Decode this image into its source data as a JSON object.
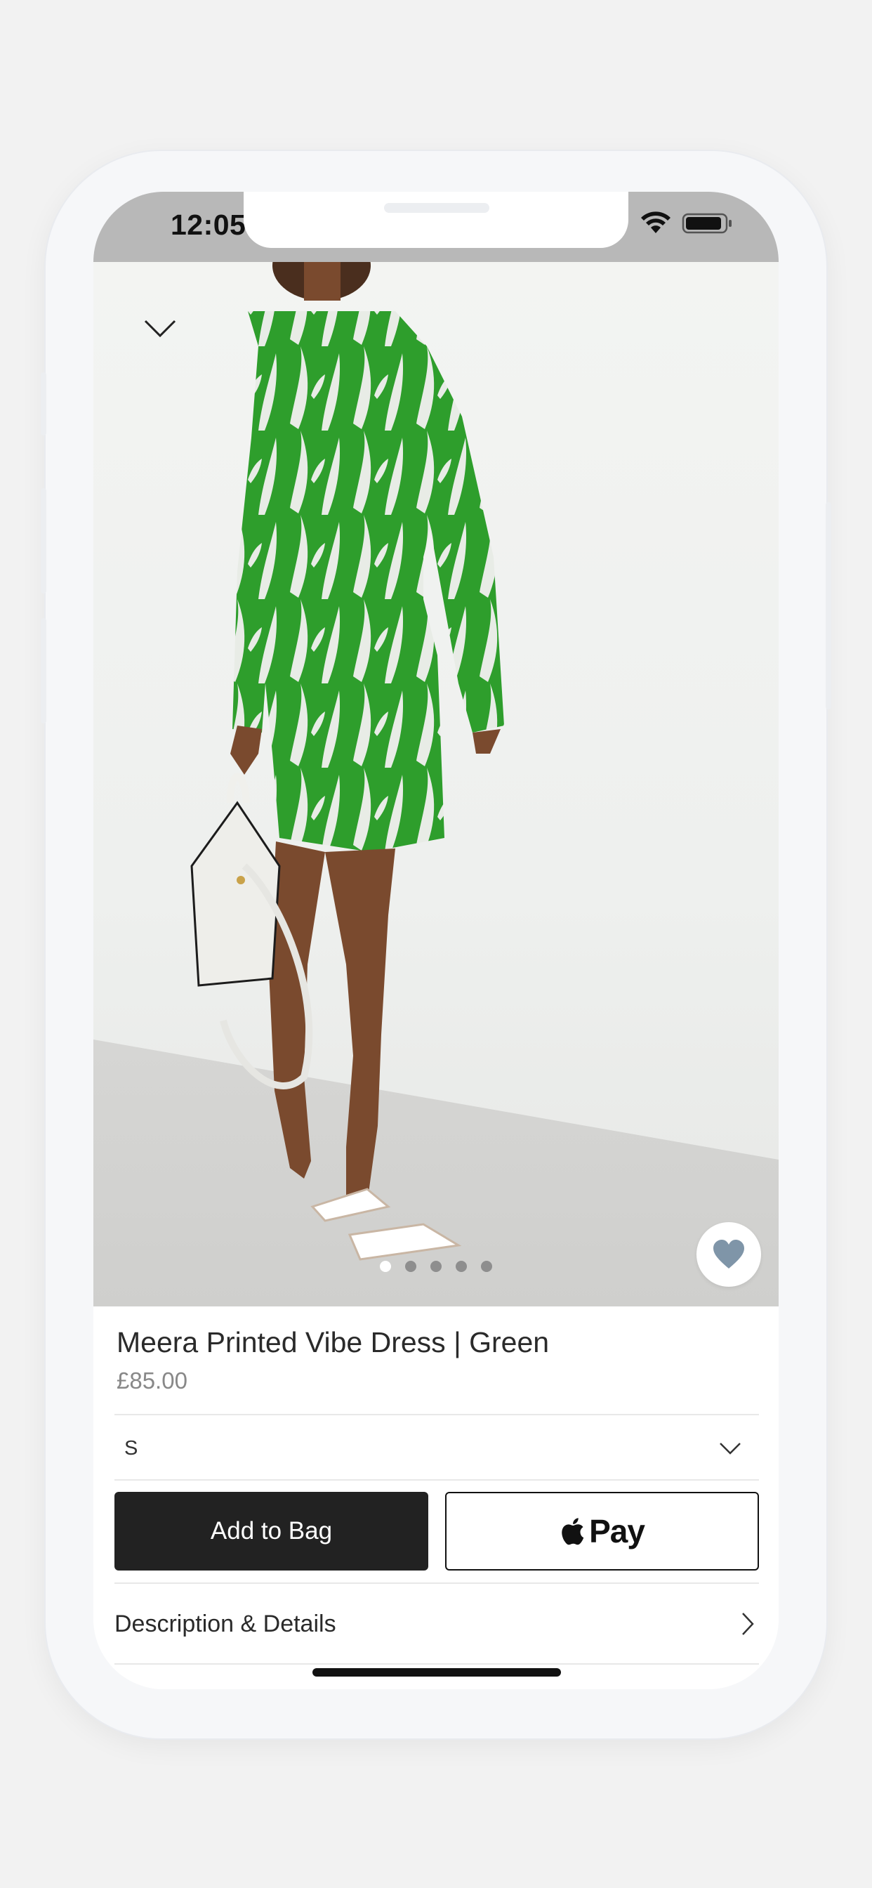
{
  "status_bar": {
    "time": "12:05"
  },
  "product": {
    "title": "Meera Printed Vibe Dress | Green",
    "price": "£85.00",
    "image_alt": "Model wearing green printed long-sleeve mini dress with white handbag and white sandals",
    "gallery": {
      "total_images": 5,
      "active_index": 0
    },
    "favorite_icon": "heart-icon"
  },
  "size_selector": {
    "selected": "S",
    "icon": "chevron-down-icon"
  },
  "actions": {
    "add_to_bag_label": "Add to Bag",
    "apple_pay_label": "Pay",
    "apple_pay_icon": "apple-logo-icon"
  },
  "details": {
    "description_label": "Description & Details",
    "icon": "chevron-right-icon"
  },
  "colors": {
    "dress_green": "#2e9e2c",
    "button_dark": "#222222",
    "favorite_heart": "#7f95a8"
  }
}
